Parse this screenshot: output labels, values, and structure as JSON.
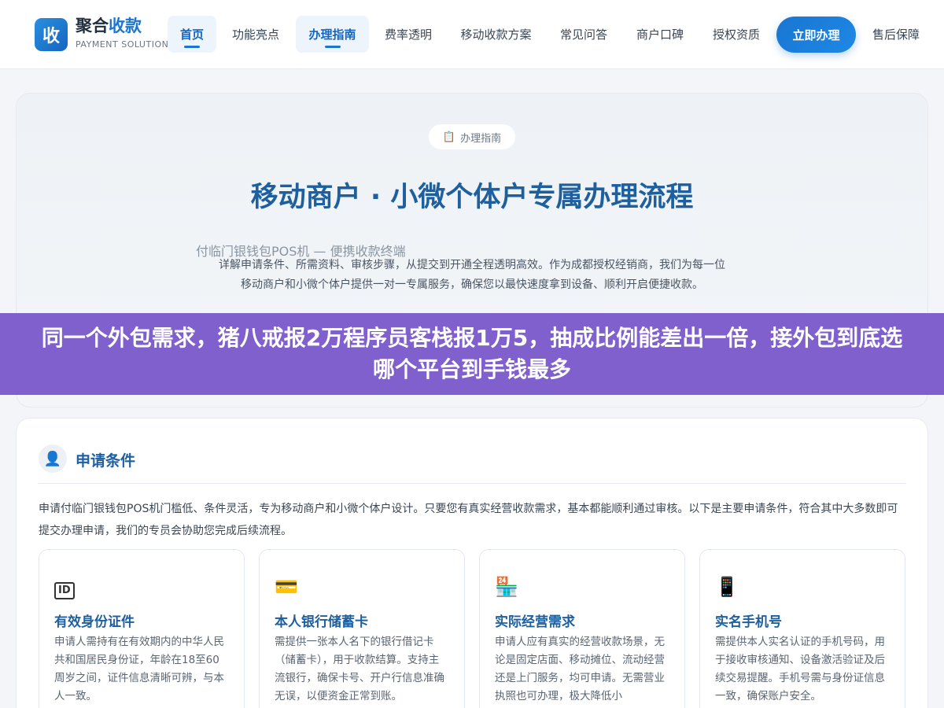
{
  "header": {
    "logo_char": "收",
    "brand_prefix": "聚合",
    "brand_accent": "收款",
    "brand_sub": "PAYMENT SOLUTIONS",
    "nav": [
      "首页",
      "功能亮点",
      "办理指南",
      "费率透明",
      "移动收款方案",
      "常见问答",
      "商户口碑",
      "授权资质"
    ],
    "cta": "立即办理",
    "after_sale": "售后保障"
  },
  "hero": {
    "badge": "办理指南",
    "title": "移动商户 · 小微个体户专属办理流程",
    "subtitle": "付临门银钱包POS机 — 便携收款终端",
    "desc": "详解申请条件、所需资料、审核步骤，从提交到开通全程透明高效。作为成都授权经销商，我们为每一位移动商户和小微个体户提供一对一专属服务，确保您以最快速度拿到设备、顺利开启便捷收款。"
  },
  "banner": {
    "text": "同一个外包需求，猪八戒报2万程序员客栈报1万5，抽成比例能差出一倍，接外包到底选哪个平台到手钱最多"
  },
  "section": {
    "title": "申请条件",
    "intro": "申请付临门银钱包POS机门槛低、条件灵活，专为移动商户和小微个体户设计。只要您有真实经营收款需求，基本都能顺利通过审核。以下是主要申请条件，符合其中大多数即可提交办理申请，我们的专员会协助您完成后续流程。",
    "cards": [
      {
        "icon": "ID",
        "title": "有效身份证件",
        "desc": "申请人需持有在有效期内的中华人民共和国居民身份证，年龄在18至60周岁之间，证件信息清晰可辨，与本人一致。"
      },
      {
        "icon": "💳",
        "title": "本人银行储蓄卡",
        "desc": "需提供一张本人名下的银行借记卡（储蓄卡），用于收款结算。支持主流银行，确保卡号、开户行信息准确无误，以便资金正常到账。"
      },
      {
        "icon": "🏪",
        "title": "实际经营需求",
        "desc": "申请人应有真实的经营收款场景，无论是固定店面、移动摊位、流动经营还是上门服务，均可申请。无需营业执照也可办理，极大降低小"
      },
      {
        "icon": "📱",
        "title": "实名手机号",
        "desc": "需提供本人实名认证的手机号码，用于接收审核通知、设备激活验证及后续交易提醒。手机号需与身份证信息一致，确保账户安全。"
      }
    ]
  }
}
